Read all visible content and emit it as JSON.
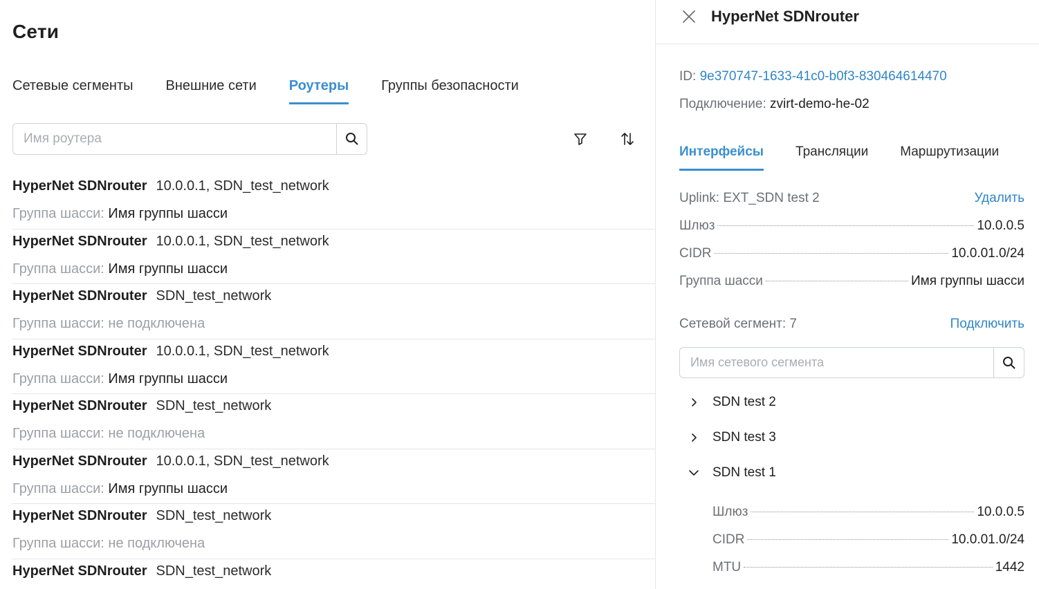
{
  "page": {
    "title": "Сети"
  },
  "tabs": [
    {
      "label": "Сетевые сегменты"
    },
    {
      "label": "Внешние сети"
    },
    {
      "label": "Роутеры"
    },
    {
      "label": "Группы безопасности"
    }
  ],
  "search": {
    "placeholder": "Имя роутера"
  },
  "routers": [
    {
      "name": "HyperNet SDNrouter",
      "networks": "10.0.0.1, SDN_test_network",
      "group_label": "Группа шасси:",
      "group_value": "Имя группы шасси"
    },
    {
      "name": "HyperNet SDNrouter",
      "networks": "10.0.0.1, SDN_test_network",
      "group_label": "Группа шасси:",
      "group_value": "Имя группы шасси"
    },
    {
      "name": "HyperNet SDNrouter",
      "networks": "SDN_test_network",
      "group_label": "Группа шасси: не подключена",
      "group_value": ""
    },
    {
      "name": "HyperNet SDNrouter",
      "networks": "10.0.0.1, SDN_test_network",
      "group_label": "Группа шасси:",
      "group_value": "Имя группы шасси"
    },
    {
      "name": "HyperNet SDNrouter",
      "networks": "SDN_test_network",
      "group_label": "Группа шасси: не подключена",
      "group_value": ""
    },
    {
      "name": "HyperNet SDNrouter",
      "networks": "10.0.0.1, SDN_test_network",
      "group_label": "Группа шасси:",
      "group_value": "Имя группы шасси"
    },
    {
      "name": "HyperNet SDNrouter",
      "networks": "SDN_test_network",
      "group_label": "Группа шасси: не подключена",
      "group_value": ""
    },
    {
      "name": "HyperNet SDNrouter",
      "networks": "SDN_test_network",
      "group_label": "",
      "group_value": ""
    }
  ],
  "detail": {
    "title": "HyperNet SDNrouter",
    "id_label": "ID:",
    "id_value": "9e370747-1633-41c0-b0f3-830464614470",
    "connection_label": "Подключение:",
    "connection_value": "zvirt-demo-he-02",
    "tabs": [
      {
        "label": "Интерфейсы"
      },
      {
        "label": "Трансляции"
      },
      {
        "label": "Маршрутизации"
      }
    ],
    "uplink": {
      "label": "Uplink: EXT_SDN test 2",
      "action": "Удалить",
      "rows": [
        {
          "key": "Шлюз",
          "value": "10.0.0.5"
        },
        {
          "key": "CIDR",
          "value": "10.0.01.0/24"
        },
        {
          "key": "Группа шасси",
          "value": "Имя группы шасси"
        }
      ]
    },
    "segments": {
      "label": "Сетевой сегмент: 7",
      "action": "Подключить",
      "search_placeholder": "Имя сетевого сегмента",
      "items": [
        {
          "label": "SDN test 2",
          "expanded": false
        },
        {
          "label": "SDN test 3",
          "expanded": false
        },
        {
          "label": "SDN test 1",
          "expanded": true
        }
      ],
      "expanded_rows": [
        {
          "key": "Шлюз",
          "value": "10.0.0.5"
        },
        {
          "key": "CIDR",
          "value": "10.0.01.0/24"
        },
        {
          "key": "MTU",
          "value": "1442"
        }
      ]
    }
  },
  "colors": {
    "accent": "#3a8fd0",
    "link": "#2f86c8",
    "muted": "#9aa0a6",
    "border": "#cfd3d8"
  }
}
